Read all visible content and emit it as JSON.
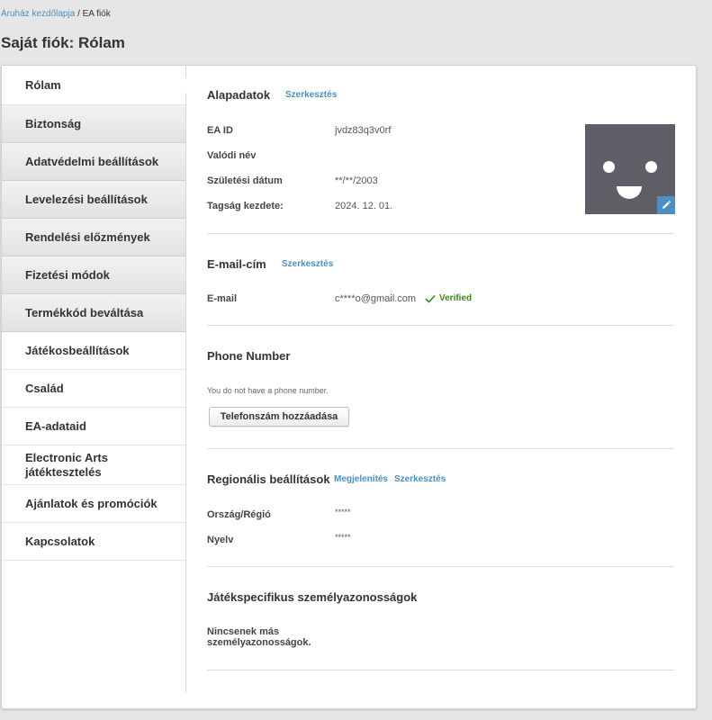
{
  "breadcrumb": {
    "home": "Áruház kezdőlapja",
    "separator": "/",
    "current": "EA fiók"
  },
  "page_title": "Saját fiók: Rólam",
  "sidebar": {
    "items": [
      {
        "label": "Rólam"
      },
      {
        "label": "Biztonság"
      },
      {
        "label": "Adatvédelmi beállítások"
      },
      {
        "label": "Levelezési beállítások"
      },
      {
        "label": "Rendelési előzmények"
      },
      {
        "label": "Fizetési módok"
      },
      {
        "label": "Termékkód beváltása"
      },
      {
        "label": "Játékosbeállítások"
      },
      {
        "label": "Család"
      },
      {
        "label": "EA-adataid"
      },
      {
        "label_line1": "Electronic Arts",
        "label_line2": "játéktesztelés"
      },
      {
        "label": "Ajánlatok és promóciók"
      },
      {
        "label": "Kapcsolatok"
      }
    ]
  },
  "basic": {
    "title": "Alapadatok",
    "edit": "Szerkesztés",
    "ea_id_label": "EA ID",
    "ea_id_value": "jvdz83q3v0rf",
    "real_name_label": "Valódi név",
    "birth_label": "Születési dátum",
    "birth_value": "**/**/2003",
    "member_label": "Tagság kezdete:",
    "member_value": "2024. 12. 01."
  },
  "email": {
    "title": "E-mail-cím",
    "edit": "Szerkesztés",
    "label": "E-mail",
    "value": "c****o@gmail.com",
    "verified": "Verified"
  },
  "phone": {
    "title": "Phone Number",
    "note": "You do not have a phone number.",
    "add_button": "Telefonszám hozzáadása"
  },
  "regional": {
    "title": "Regionális beállítások",
    "show": "Megjelenítés",
    "edit": "Szerkesztés",
    "country_label": "Ország/Régió",
    "country_value": "*****",
    "language_label": "Nyelv",
    "language_value": "*****"
  },
  "game_ids": {
    "title": "Játékspecifikus személyazonosságok",
    "none_line1": "Nincsenek más",
    "none_line2": "személyazonosságok."
  },
  "colors": {
    "link": "#4a90c2",
    "verified": "#3c8a1e",
    "avatar_bg": "#5f5d66"
  },
  "icons": {
    "edit_avatar": "pencil-icon",
    "verified": "checkmark-icon"
  }
}
